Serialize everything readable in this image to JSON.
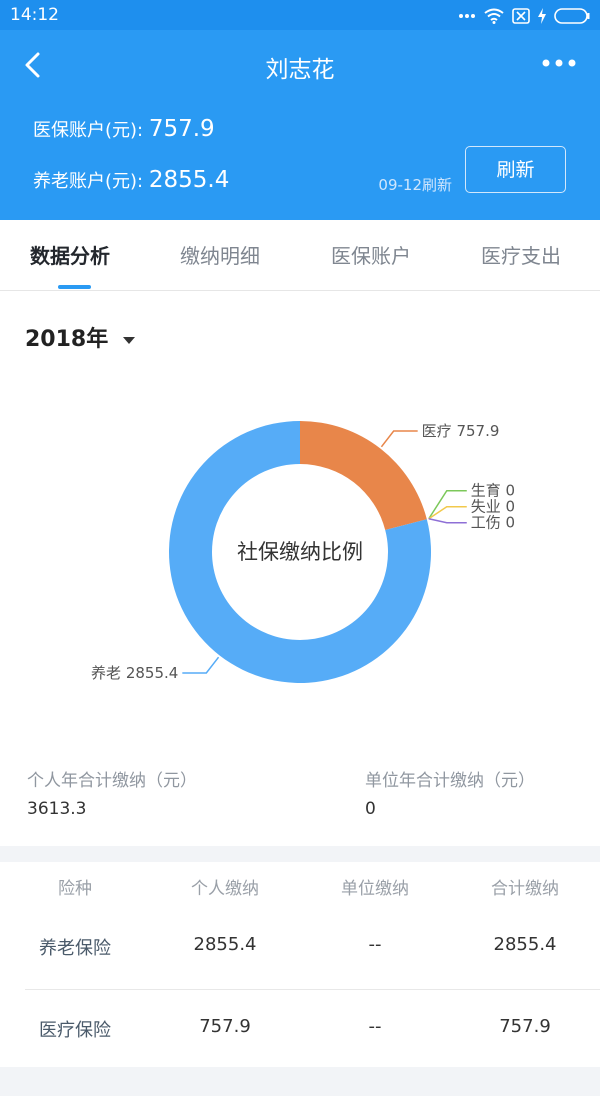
{
  "status": {
    "time": "14:12"
  },
  "header": {
    "title": "刘志花",
    "medical_label": "医保账户(元):",
    "medical_value": "757.9",
    "pension_label": "养老账户(元):",
    "pension_value": "2855.4",
    "refresh_note": "09-12刷新",
    "refresh_label": "刷新"
  },
  "tabs": [
    {
      "label": "数据分析"
    },
    {
      "label": "缴纳明细"
    },
    {
      "label": "医保账户"
    },
    {
      "label": "医疗支出"
    }
  ],
  "year": {
    "label": "2018年"
  },
  "chart_data": {
    "type": "pie",
    "title": "社保缴纳比例",
    "slices": [
      {
        "label": "医疗",
        "value": 757.9,
        "color": "#e8864a"
      },
      {
        "label": "生育",
        "value": 0,
        "color": "#7cc85a"
      },
      {
        "label": "失业",
        "value": 0,
        "color": "#f2c94c"
      },
      {
        "label": "工伤",
        "value": 0,
        "color": "#8e6fd6"
      },
      {
        "label": "养老",
        "value": 2855.4,
        "color": "#56acf7"
      }
    ]
  },
  "summary": {
    "personal_label": "个人年合计缴纳（元）",
    "personal_value": "3613.3",
    "unit_label": "单位年合计缴纳（元）",
    "unit_value": "0"
  },
  "table": {
    "headers": [
      "险种",
      "个人缴纳",
      "单位缴纳",
      "合计缴纳"
    ],
    "rows": [
      [
        "养老保险",
        "2855.4",
        "--",
        "2855.4"
      ],
      [
        "医疗保险",
        "757.9",
        "--",
        "757.9"
      ]
    ]
  }
}
